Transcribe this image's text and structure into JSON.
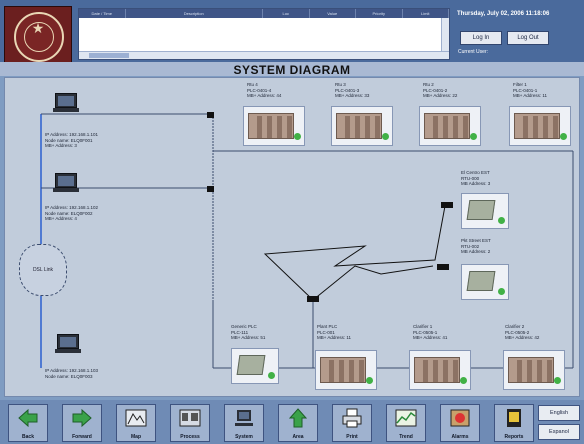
{
  "header": {
    "alarm_columns": [
      "Date / Time",
      "Description",
      "Loc",
      "Value",
      "Priority",
      "Limit"
    ],
    "datetime": "Thursday, July 02, 2006 11:18:06",
    "login_label": "Log In",
    "logout_label": "Log Out",
    "current_user_label": "Current User:"
  },
  "page_title": "SYSTEM DIAGRAM",
  "workstations": [
    {
      "lines": [
        "IP Address: 192.168.1.101",
        "Node name: ELQ0F001",
        "MB+ Address: 3"
      ]
    },
    {
      "lines": [
        "IP Address: 192.168.1.102",
        "Node name: ELQ0F002",
        "MB+ Address: 4"
      ]
    },
    {
      "lines": [
        "IP Address: 192.168.1.103",
        "Node name: ELQ0F003",
        "MB+ Address: 5"
      ]
    }
  ],
  "network_label": "DSL Link",
  "plcs_top": [
    {
      "lines": [
        "Rtu 4",
        "PLC-0401-4",
        "MB+ Address: 44"
      ]
    },
    {
      "lines": [
        "Rtu 3",
        "PLC-0401-3",
        "MB+ Address: 33"
      ]
    },
    {
      "lines": [
        "Rtu 2",
        "PLC-0401-2",
        "MB+ Address: 22"
      ]
    },
    {
      "lines": [
        "Filter 1",
        "PLC-0401-1",
        "MB+ Address: 11"
      ]
    }
  ],
  "radio_devices": [
    {
      "lines": [
        "El Centro EST",
        "RTU-000",
        "MB Address: 3"
      ]
    },
    {
      "lines": [
        "Pkt Street EST",
        "RTU-002",
        "MB Address: 2"
      ]
    }
  ],
  "plcs_bottom": [
    {
      "lines": [
        "Generic PLC",
        "PLC-111",
        "MB+ Address: 51"
      ]
    },
    {
      "lines": [
        "Plant PLC",
        "PLC-001",
        "MB+ Address: 11"
      ]
    },
    {
      "lines": [
        "Clarifier 1",
        "PLC-0505-1",
        "MB+ Address: 41"
      ]
    },
    {
      "lines": [
        "Clarifier 2",
        "PLC-0505-2",
        "MB+ Address: 42"
      ]
    }
  ],
  "nav": [
    {
      "label": "Back",
      "icon": "arrow-left-icon"
    },
    {
      "label": "Forward",
      "icon": "arrow-right-icon"
    },
    {
      "label": "Map",
      "icon": "map-icon"
    },
    {
      "label": "Process",
      "icon": "process-icon"
    },
    {
      "label": "System",
      "icon": "computer-icon"
    },
    {
      "label": "Area",
      "icon": "arrow-up-icon"
    },
    {
      "label": "Print",
      "icon": "printer-icon"
    },
    {
      "label": "Trend",
      "icon": "trend-icon"
    },
    {
      "label": "Alarms",
      "icon": "alarm-icon"
    },
    {
      "label": "Reports",
      "icon": "report-icon"
    }
  ],
  "language": {
    "english": "English",
    "espanol": "Espanol"
  },
  "colors": {
    "status_ok": "#41b146",
    "link_line": "#3b4c6e",
    "highlight_link": "#2a5fcf"
  }
}
